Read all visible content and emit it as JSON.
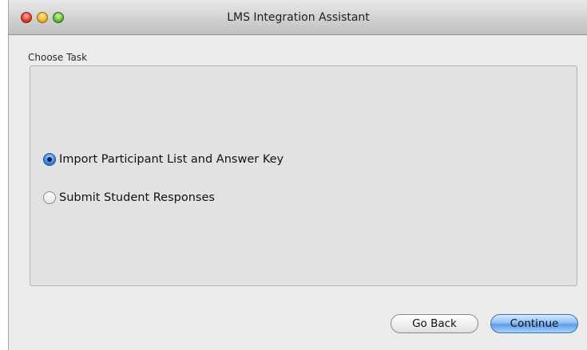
{
  "window": {
    "title": "LMS Integration Assistant"
  },
  "task_group": {
    "label": "Choose Task",
    "options": [
      {
        "label": "Import Participant List and Answer Key",
        "selected": true
      },
      {
        "label": "Submit Student Responses",
        "selected": false
      }
    ]
  },
  "buttons": {
    "back_label": "Go Back",
    "continue_label": "Continue"
  },
  "colors": {
    "accent": "#5c9de8",
    "window_background": "#ececec"
  }
}
